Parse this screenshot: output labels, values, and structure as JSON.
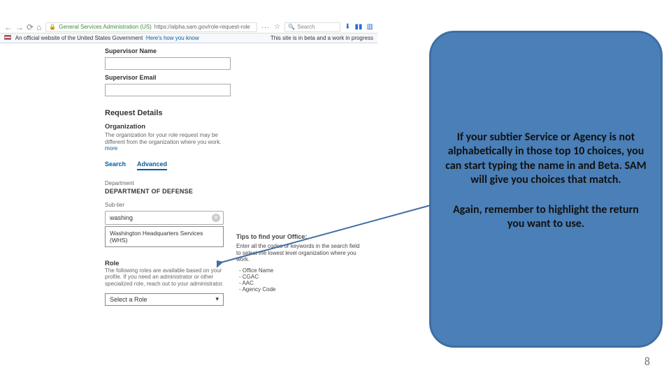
{
  "browser": {
    "org_name": "General Services Administration (US)",
    "url": "https://alpha.sam.gov/role-request-role",
    "search_placeholder": "Search"
  },
  "banner": {
    "left_text": "An official website of the United States Government",
    "hows_link": "Here's how you know",
    "right_text": "This site is in beta and a work in progress"
  },
  "form": {
    "supervisor_name_label": "Supervisor Name",
    "supervisor_email_label": "Supervisor Email",
    "request_details_title": "Request Details",
    "organization_label": "Organization",
    "organization_help": "The organization for your role request may be different from the organization where you work.",
    "more_link": "more",
    "tab_search": "Search",
    "tab_advanced": "Advanced",
    "department_label": "Department",
    "department_value": "DEPARTMENT OF DEFENSE",
    "subtier_label": "Sub-tier",
    "subtier_value": "washing",
    "subtier_suggestion": "Washington Headquarters Services (WHS)",
    "role_label": "Role",
    "role_help": "The following roles are available based on your profile. If you need an administrator or other specialized role, reach out to your administrator.",
    "role_placeholder": "Select a Role"
  },
  "tips": {
    "title": "Tips to find your Office:",
    "body": "Enter all the codes or keywords in the search field to select the lowest level organization where you work.",
    "items": [
      "Office Name",
      "CGAC",
      "AAC",
      "Agency Code"
    ]
  },
  "callout": {
    "p1": "If your subtier Service or Agency is not alphabetically in those top 10 choices, you can start typing the name in and Beta. SAM will give you choices that match.",
    "p2": "Again, remember to highlight the return you want to use."
  },
  "page_number": "8"
}
